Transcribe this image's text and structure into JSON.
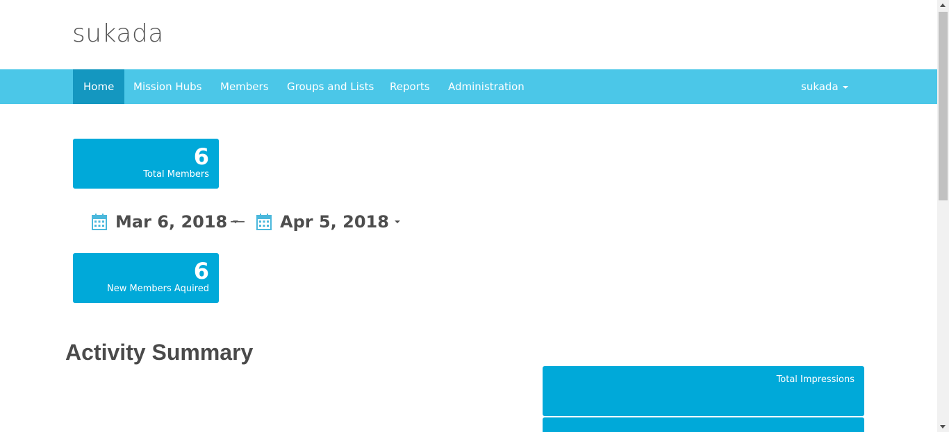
{
  "brand": {
    "title": "sukada"
  },
  "nav": {
    "items": [
      {
        "label": "Home",
        "active": true
      },
      {
        "label": "Mission Hubs",
        "active": false
      },
      {
        "label": "Members",
        "active": false
      },
      {
        "label": "Groups and Lists",
        "active": false
      },
      {
        "label": "Reports",
        "active": false
      },
      {
        "label": "Administration",
        "active": false
      }
    ],
    "user": {
      "label": "sukada"
    }
  },
  "stats": {
    "total_members": {
      "value": "6",
      "label": "Total Members"
    },
    "new_members": {
      "value": "6",
      "label": "New Members Aquired"
    }
  },
  "date_range": {
    "start": "Mar 6, 2018",
    "separator": "—",
    "end": "Apr 5, 2018"
  },
  "activity": {
    "title": "Activity Summary",
    "impressions_label": "Total Impressions"
  },
  "icons": {
    "calendar": "calendar-icon",
    "caret": "caret-down-icon"
  },
  "colors": {
    "navbar": "#4bc7e8",
    "nav_active": "#1497c0",
    "card": "#00a9d9",
    "calendar_icon": "#4bb8dc",
    "heading_text": "#4a4a4a"
  }
}
